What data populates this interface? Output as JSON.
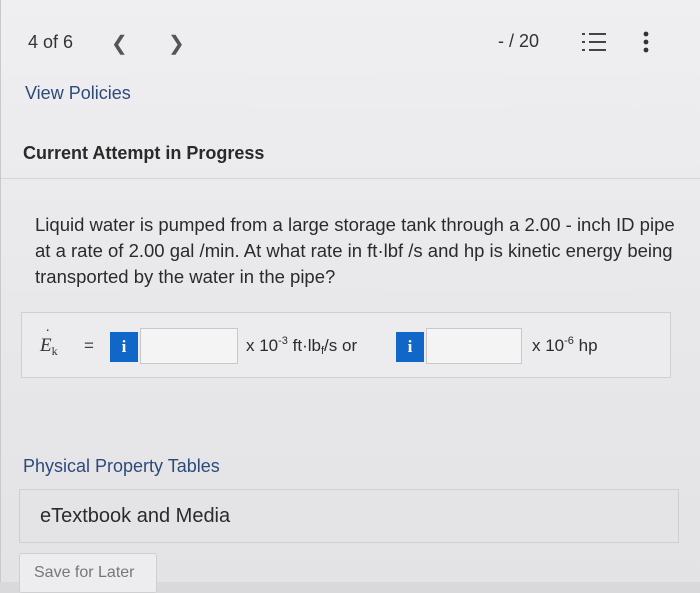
{
  "header": {
    "counter": "4 of 6",
    "prev_icon": "chevron-left",
    "next_icon": "chevron-right",
    "score": "- / 20",
    "list_icon": "numbered-list",
    "more_icon": "more-vertical"
  },
  "links": {
    "view_policies": "View Policies",
    "physical_tables": "Physical Property Tables"
  },
  "attempt_title": "Current Attempt in Progress",
  "question": "Liquid water is pumped from a large storage tank through a 2.00 - inch ID pipe at a rate of 2.00 gal /min. At what rate in ft·lbf /s and hp is kinetic energy being transported by the water in the pipe?",
  "answer": {
    "symbol": "E",
    "symbol_sub": "k",
    "equals": "=",
    "info_badge": "i",
    "field1_value": "",
    "unit1_prefix": "x 10",
    "unit1_exp": "-3",
    "unit1_text": " ft·lb",
    "unit1_sub": "f",
    "unit1_suffix": "/s or",
    "field2_value": "",
    "unit2_prefix": "x 10",
    "unit2_exp": "-6",
    "unit2_suffix": " hp"
  },
  "etextbook_label": "eTextbook and Media",
  "save_label": "Save for Later",
  "colors": {
    "accent": "#1167c7",
    "link": "#2d4a7a"
  }
}
